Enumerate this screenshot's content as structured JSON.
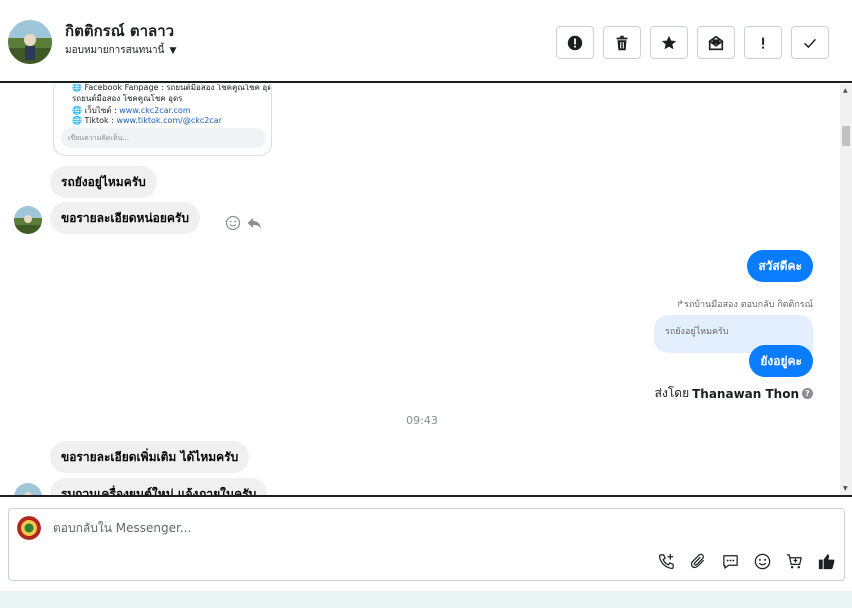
{
  "header": {
    "contact_name": "กิตติกรณ์ ตาลาว",
    "assign_label": "มอบหมายการสนทนานี้",
    "actions": [
      {
        "name": "report-spam-button",
        "icon": "alert-circle-icon"
      },
      {
        "name": "delete-button",
        "icon": "trash-icon"
      },
      {
        "name": "star-button",
        "icon": "star-icon"
      },
      {
        "name": "mark-unread-button",
        "icon": "envelope-icon"
      },
      {
        "name": "follow-up-button",
        "icon": "exclamation-icon"
      },
      {
        "name": "mark-done-button",
        "icon": "check-icon"
      }
    ]
  },
  "preview_card": {
    "lines": [
      {
        "prefix": "🌐 Facebook Fanpage : ",
        "text": "รถยนต์มือสอง โชคคูณโชค อุดร",
        "link": ""
      },
      {
        "prefix": "",
        "text": "รถยนต์มือสอง โชคคูณโชค อุดร",
        "link": ""
      },
      {
        "prefix": "🌐 เว็บไซต์ : ",
        "text": "",
        "link": "www.ckc2car.com"
      },
      {
        "prefix": "🌐 Tiktok : ",
        "text": "",
        "link": "www.tiktok.com/@ckc2car"
      }
    ],
    "comment_placeholder": "เขียนความคิดเห็น..."
  },
  "messages": {
    "in_1": "รถยังอยู่ไหมครับ",
    "in_2": "ขอรายละเอียดหน่อยครับ",
    "out_1": "สวัสดีคะ",
    "reply_meta": "↱รถบ้านมือสอง ตอบกลับ กิตติกรณ์",
    "reply_quote": "รถยังอยู่ไหมครับ",
    "out_2": "ยังอยู่คะ",
    "sent_by_prefix": "ส่งโดย",
    "sent_by_name": "Thanawan Thon",
    "timestamp": "09:43",
    "in_3": "ขอรายละเอียดเพิ่มเติม ได้ไหมครับ",
    "in_4": "รบกวนเครื่องยนต์ใหม่ แจ้งภายในครับ"
  },
  "composer": {
    "placeholder": "ตอบกลับใน Messenger..."
  },
  "colors": {
    "outgoing_bubble": "#0a7cff",
    "incoming_bubble": "#f0f0f0",
    "reply_quote_bg": "#e4effe"
  }
}
